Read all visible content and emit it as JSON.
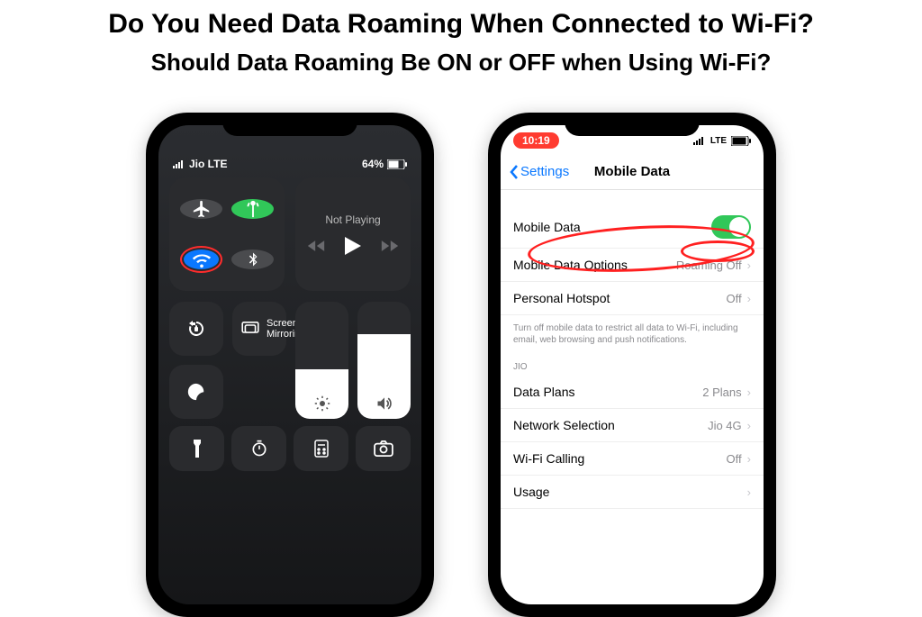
{
  "headings": {
    "h1": "Do You Need Data Roaming When Connected to Wi-Fi?",
    "h2": "Should Data Roaming Be ON or OFF when Using Wi-Fi?"
  },
  "left_phone": {
    "carrier": "Jio LTE",
    "battery": "64%",
    "media_label": "Not Playing",
    "mirror_label": "Screen Mirroring"
  },
  "right_phone": {
    "time": "10:19",
    "lte_label": "LTE",
    "back_label": "Settings",
    "nav_title": "Mobile Data",
    "rows": {
      "mobile_data": "Mobile Data",
      "mobile_data_options": "Mobile Data Options",
      "mobile_data_options_val": "Roaming Off",
      "personal_hotspot": "Personal Hotspot",
      "personal_hotspot_val": "Off",
      "footnote": "Turn off mobile data to restrict all data to Wi-Fi, including email, web browsing and push notifications.",
      "section": "JIO",
      "data_plans": "Data Plans",
      "data_plans_val": "2 Plans",
      "network_selection": "Network Selection",
      "network_selection_val": "Jio 4G",
      "wifi_calling": "Wi-Fi Calling",
      "wifi_calling_val": "Off",
      "usage": "Usage"
    }
  }
}
